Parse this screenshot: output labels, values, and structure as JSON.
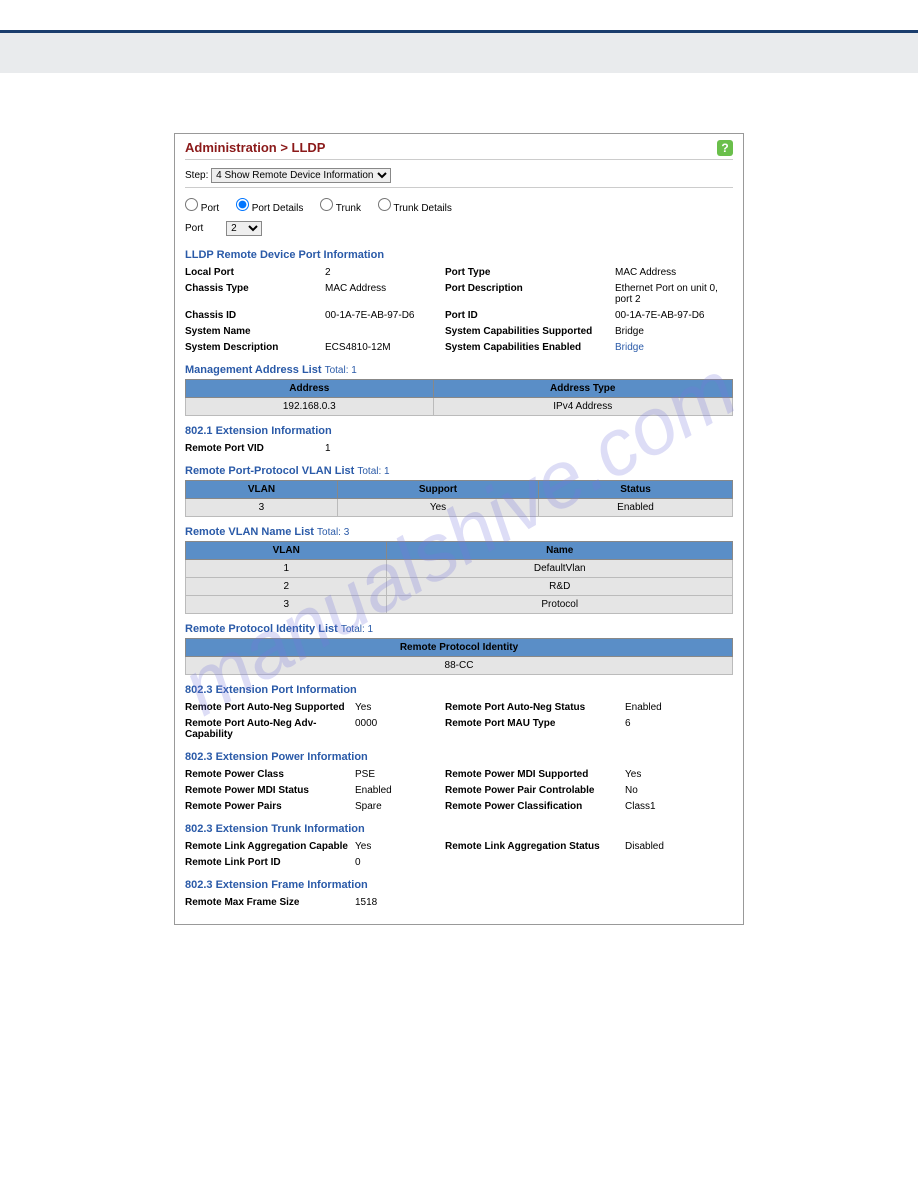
{
  "breadcrumb": "Administration > LLDP",
  "step_label": "Step:",
  "step_value": "4  Show Remote Device Information",
  "radios": {
    "port": "Port",
    "port_details": "Port Details",
    "trunk": "Trunk",
    "trunk_details": "Trunk Details"
  },
  "port_label": "Port",
  "port_value": "2",
  "sec_remote_port": {
    "title": "LLDP Remote Device Port Information",
    "rows": [
      {
        "l1": "Local Port",
        "v1": "2",
        "l2": "Port Type",
        "v2": "MAC Address"
      },
      {
        "l1": "Chassis Type",
        "v1": "MAC Address",
        "l2": "Port Description",
        "v2": "Ethernet Port on unit 0, port 2"
      },
      {
        "l1": "Chassis ID",
        "v1": "00-1A-7E-AB-97-D6",
        "l2": "Port ID",
        "v2": "00-1A-7E-AB-97-D6"
      },
      {
        "l1": "System Name",
        "v1": "",
        "l2": "System Capabilities Supported",
        "v2": "Bridge"
      },
      {
        "l1": "System Description",
        "v1": "ECS4810-12M",
        "l2": "System Capabilities Enabled",
        "v2": "Bridge",
        "v2link": true
      }
    ]
  },
  "mgmt_addr": {
    "title": "Management Address List",
    "total": "Total: 1",
    "headers": [
      "Address",
      "Address Type"
    ],
    "rows": [
      [
        "192.168.0.3",
        "IPv4 Address"
      ]
    ]
  },
  "ext_8021": {
    "title": "802.1 Extension Information",
    "label": "Remote Port VID",
    "value": "1"
  },
  "port_proto_vlan": {
    "title": "Remote Port-Protocol VLAN List",
    "total": "Total: 1",
    "headers": [
      "VLAN",
      "Support",
      "Status"
    ],
    "rows": [
      [
        "3",
        "Yes",
        "Enabled"
      ]
    ]
  },
  "vlan_name": {
    "title": "Remote VLAN Name List",
    "total": "Total: 3",
    "headers": [
      "VLAN",
      "Name"
    ],
    "rows": [
      [
        "1",
        "DefaultVlan"
      ],
      [
        "2",
        "R&D"
      ],
      [
        "3",
        "Protocol"
      ]
    ]
  },
  "proto_id": {
    "title": "Remote Protocol Identity List",
    "total": "Total: 1",
    "headers": [
      "Remote Protocol Identity"
    ],
    "rows": [
      [
        "88-CC"
      ]
    ]
  },
  "ext_8023_port": {
    "title": "802.3 Extension Port Information",
    "rows": [
      {
        "l1": "Remote Port Auto-Neg Supported",
        "v1": "Yes",
        "l2": "Remote Port Auto-Neg Status",
        "v2": "Enabled"
      },
      {
        "l1": "Remote Port Auto-Neg Adv-Capability",
        "v1": "0000",
        "l2": "Remote Port MAU Type",
        "v2": "6"
      }
    ]
  },
  "ext_8023_power": {
    "title": "802.3 Extension Power Information",
    "rows": [
      {
        "l1": "Remote Power Class",
        "v1": "PSE",
        "l2": "Remote Power MDI Supported",
        "v2": "Yes"
      },
      {
        "l1": "Remote Power MDI Status",
        "v1": "Enabled",
        "l2": "Remote Power Pair Controlable",
        "v2": "No"
      },
      {
        "l1": "Remote Power Pairs",
        "v1": "Spare",
        "l2": "Remote Power Classification",
        "v2": "Class1"
      }
    ]
  },
  "ext_8023_trunk": {
    "title": "802.3 Extension Trunk Information",
    "rows": [
      {
        "l1": "Remote Link Aggregation Capable",
        "v1": "Yes",
        "l2": "Remote Link Aggregation Status",
        "v2": "Disabled"
      },
      {
        "l1": "Remote Link Port ID",
        "v1": "0",
        "l2": "",
        "v2": ""
      }
    ]
  },
  "ext_8023_frame": {
    "title": "802.3 Extension Frame Information",
    "label": "Remote Max Frame Size",
    "value": "1518"
  },
  "watermark": "manualshive.com"
}
